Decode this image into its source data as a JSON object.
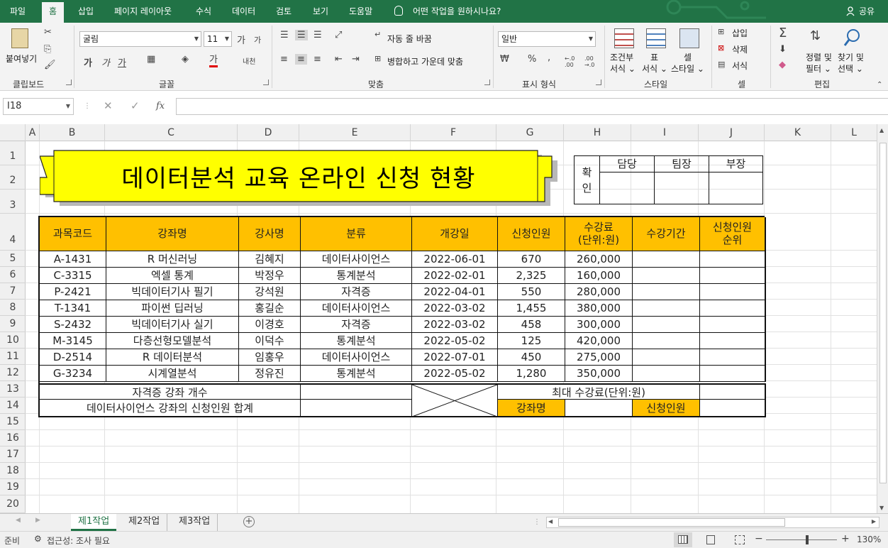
{
  "ribbon_tabs": [
    "파일",
    "홈",
    "삽입",
    "페이지 레이아웃",
    "수식",
    "데이터",
    "검토",
    "보기",
    "도움말"
  ],
  "tell_me": "어떤 작업을 원하시나요?",
  "share": "공유",
  "clipboard": {
    "paste": "붙여넣기",
    "label": "클립보드"
  },
  "font": {
    "name": "굴림",
    "size": "11",
    "grow": "가",
    "shrink": "가",
    "bold": "가",
    "italic": "가",
    "underline": "가",
    "color_letter": "가",
    "phonetic": "내천",
    "label": "글꼴"
  },
  "alignment": {
    "wrap": "자동 줄 바꿈",
    "merge": "병합하고 가운데 맞춤",
    "label": "맞춤"
  },
  "number": {
    "format": "일반",
    "percent": "%",
    "comma": ",",
    "inc": "←.0 .00",
    "dec": ".00 →.0",
    "label": "표시 형식"
  },
  "styles": {
    "cond": [
      "조건부",
      "서식 ⌄"
    ],
    "table": [
      "표",
      "서식 ⌄"
    ],
    "cell": [
      "셀",
      "스타일 ⌄"
    ],
    "label": "스타일"
  },
  "cells": {
    "insert": "삽입",
    "delete": "삭제",
    "format": "서식",
    "label": "셀"
  },
  "editing": {
    "sort": [
      "정렬 및",
      "필터 ⌄"
    ],
    "find": [
      "찾기 및",
      "선택 ⌄"
    ],
    "label": "편집"
  },
  "formula_bar": {
    "name_box": "I18",
    "fx": "fx",
    "value": ""
  },
  "columns": [
    "A",
    "B",
    "C",
    "D",
    "E",
    "F",
    "G",
    "H",
    "I",
    "J",
    "K",
    "L"
  ],
  "rows": [
    "1",
    "2",
    "3",
    "4",
    "5",
    "6",
    "7",
    "8",
    "9",
    "10",
    "11",
    "12",
    "13",
    "14",
    "15",
    "16",
    "17",
    "18",
    "19",
    "20"
  ],
  "title": "데이터분석 교육 온라인 신청 현황",
  "approval": {
    "label": [
      "확",
      "인"
    ],
    "roles": [
      "담당",
      "팀장",
      "부장"
    ]
  },
  "table": {
    "headers": [
      "과목코드",
      "강좌명",
      "강사명",
      "분류",
      "개강일",
      "신청인원",
      "수강료\n(단위:원)",
      "수강기간",
      "신청인원\n순위"
    ],
    "rows": [
      [
        "A-1431",
        "R 머신러닝",
        "김혜지",
        "데이터사이언스",
        "2022-06-01",
        "670",
        "260,000",
        "",
        ""
      ],
      [
        "C-3315",
        "엑셀 통계",
        "박정우",
        "통계분석",
        "2022-02-01",
        "2,325",
        "160,000",
        "",
        ""
      ],
      [
        "P-2421",
        "빅데이터기사 필기",
        "강석원",
        "자격증",
        "2022-04-01",
        "550",
        "280,000",
        "",
        ""
      ],
      [
        "T-1341",
        "파이썬 딥러닝",
        "홍길순",
        "데이터사이언스",
        "2022-03-02",
        "1,455",
        "380,000",
        "",
        ""
      ],
      [
        "S-2432",
        "빅데이터기사 실기",
        "이경호",
        "자격증",
        "2022-03-02",
        "458",
        "300,000",
        "",
        ""
      ],
      [
        "M-3145",
        "다층선형모델분석",
        "이덕수",
        "통계분석",
        "2022-05-02",
        "125",
        "420,000",
        "",
        ""
      ],
      [
        "D-2514",
        "R 데이터분석",
        "임홍우",
        "데이터사이언스",
        "2022-07-01",
        "450",
        "275,000",
        "",
        ""
      ],
      [
        "G-3234",
        "시계열분석",
        "정유진",
        "통계분석",
        "2022-05-02",
        "1,280",
        "350,000",
        "",
        ""
      ]
    ],
    "summary": {
      "cert_count": "자격증 강좌 개수",
      "ds_sum": "데이터사이언스 강좌의 신청인원 합계",
      "max_fee": "최대 수강료(단위:원)",
      "course_name": "강좌명",
      "applicants": "신청인원"
    }
  },
  "sheet_tabs": [
    "제1작업",
    "제2작업",
    "제3작업"
  ],
  "status": {
    "ready": "준비",
    "accessibility": "접근성: 조사 필요",
    "zoom": "130%"
  },
  "colors": {
    "brand": "#217346",
    "header_fill": "#ffc000",
    "banner_fill": "#ffff00"
  }
}
